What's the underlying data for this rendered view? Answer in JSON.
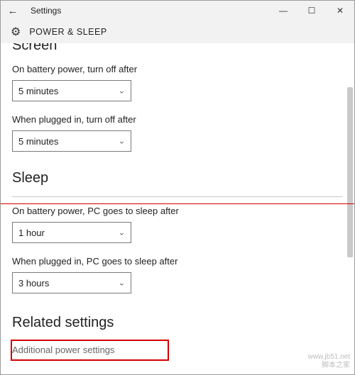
{
  "window": {
    "title": "Settings",
    "page_title": "POWER & SLEEP"
  },
  "screen": {
    "heading": "Screen",
    "battery_label": "On battery power, turn off after",
    "battery_value": "5 minutes",
    "plugged_label": "When plugged in, turn off after",
    "plugged_value": "5 minutes"
  },
  "sleep": {
    "heading": "Sleep",
    "battery_label": "On battery power, PC goes to sleep after",
    "battery_value": "1 hour",
    "plugged_label": "When plugged in, PC goes to sleep after",
    "plugged_value": "3 hours"
  },
  "related": {
    "heading": "Related settings",
    "link": "Additional power settings"
  },
  "watermark": {
    "line1": "www.jb51.net",
    "line2": "脚本之家"
  }
}
